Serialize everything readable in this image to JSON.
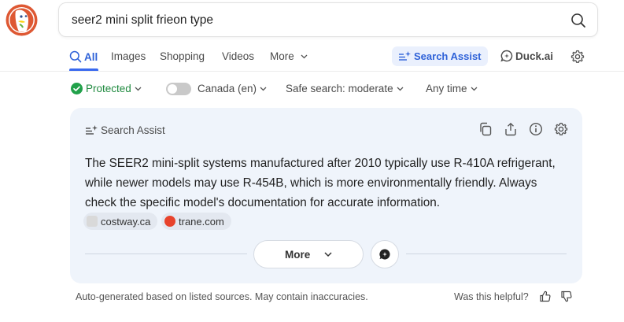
{
  "header": {
    "query": "seer2 mini split frieon type"
  },
  "tabs": [
    {
      "label": "All"
    },
    {
      "label": "Images"
    },
    {
      "label": "Shopping"
    },
    {
      "label": "Videos"
    },
    {
      "label": "More"
    }
  ],
  "actions": {
    "search_assist_label": "Search Assist",
    "duck_ai_label": "Duck.ai"
  },
  "filters": {
    "protected_label": "Protected",
    "region_label": "Canada (en)",
    "safe_search_label": "Safe search: moderate",
    "time_label": "Any time"
  },
  "assist_card": {
    "title": "Search Assist",
    "answer": "The SEER2 mini-split systems manufactured after 2010 typically use R-410A refrigerant, while newer models may use R-454B, which is more environmentally friendly. Always check the specific model's documentation for accurate information.",
    "sources": [
      {
        "label": "costway.ca",
        "color": "#d9d9d9"
      },
      {
        "label": "trane.com",
        "color": "#e8432c"
      }
    ],
    "more_label": "More"
  },
  "footer": {
    "disclaimer": "Auto-generated based on listed sources. May contain inaccuracies.",
    "helpful_label": "Was this helpful?"
  },
  "colors": {
    "accent": "#3969ef",
    "protected_green": "#1f8a3f",
    "card_bg": "#eff4fb"
  }
}
